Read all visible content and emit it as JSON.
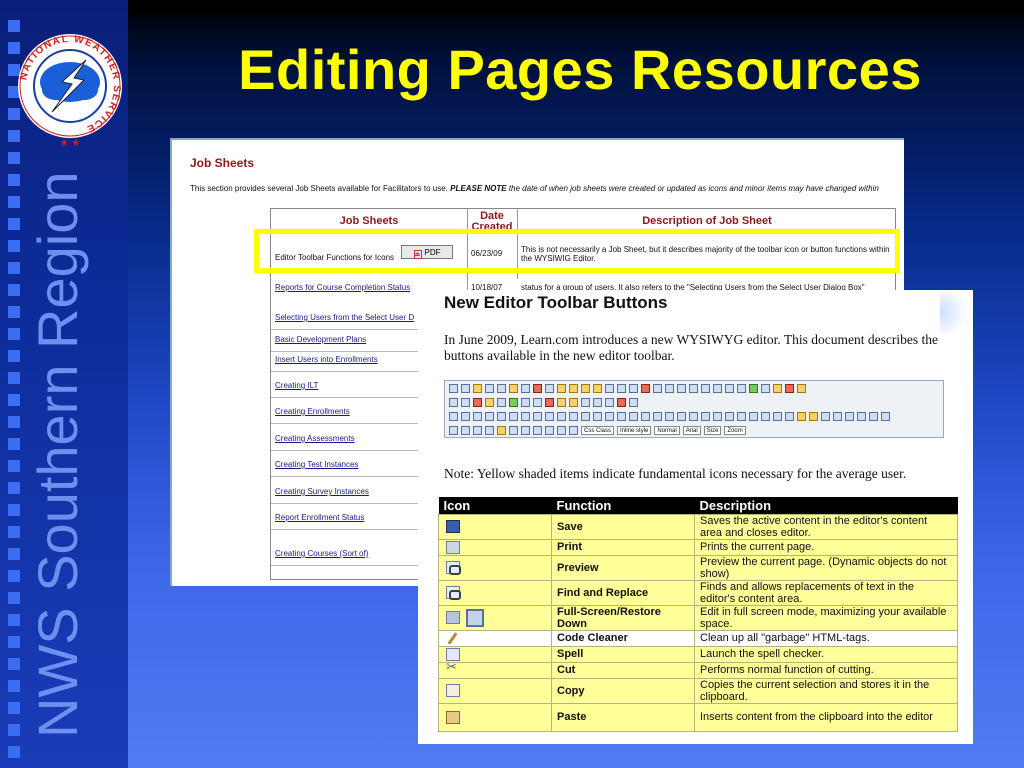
{
  "slide": {
    "title": "Editing Pages Resources",
    "side_title": "NWS Southern Region",
    "logo_ring_text": "NATIONAL WEATHER SERVICE"
  },
  "job_sheets": {
    "title": "Job Sheets",
    "intro_plain": "This section provides several Job Sheets available for Facilitators to use.",
    "intro_note": "PLEASE NOTE",
    "intro_rest": "the date of when job sheets were created or updated as icons and minor items may have changed within",
    "headers": {
      "sheet": "Job Sheets",
      "date": "Date Created",
      "desc": "Description of Job Sheet"
    },
    "pdf_label": "PDF",
    "rows": [
      {
        "name": "Editor Toolbar Functions for Icons",
        "date": "06/23/09",
        "desc": "This is not necessarily a Job Sheet, but it describes majority of the toolbar icon or button functions within the WYSIWIG Editor."
      },
      {
        "name": "Reports for Course Completion Status",
        "date": "10/18/07",
        "desc": "status for a group of users. It also refers to the \"Selecting Users from the Select User Dialog Box\""
      },
      {
        "name": "Selecting Users from the Select User D"
      },
      {
        "name": "Basic Development Plans"
      },
      {
        "name": "Insert Users into Enrollments"
      },
      {
        "name": "Creating ILT"
      },
      {
        "name": "Creating Enrollments"
      },
      {
        "name": "Creating Assessments"
      },
      {
        "name": "Creating Test Instances"
      },
      {
        "name": "Creating Survey Instances"
      },
      {
        "name": "Report Enrollment Status"
      },
      {
        "name": "Creating Courses (Sort of)"
      }
    ]
  },
  "editor_doc": {
    "title": "New Editor Toolbar Buttons",
    "intro": "In June 2009, Learn.com introduces a new WYSIWYG editor. This document describes the buttons available in the new editor toolbar.",
    "toolbar_selects": [
      "Css Class",
      "Inline style",
      "Normal",
      "Arial",
      "Size",
      "Zoom"
    ],
    "note": "Note: Yellow shaded items indicate fundamental icons necessary for the average user.",
    "table_headers": {
      "icon": "Icon",
      "function": "Function",
      "description": "Description"
    },
    "rows": [
      {
        "icon": "save-icon",
        "function": "Save",
        "description": "Saves the active content in the editor's content area and closes editor.",
        "shade": "yellow"
      },
      {
        "icon": "print-icon",
        "function": "Print",
        "description": "Prints the current page.",
        "shade": "yellow"
      },
      {
        "icon": "preview-icon",
        "function": "Preview",
        "description": "Preview the current page. (Dynamic objects do not show)",
        "shade": "yellow"
      },
      {
        "icon": "find-replace-icon",
        "function": "Find and Replace",
        "description": "Finds and allows replacements of text in the editor's content area.",
        "shade": "yellow"
      },
      {
        "icon": "fullscreen-icon",
        "function": "Full-Screen/Restore Down",
        "description": "Edit in full screen mode, maximizing your available space.",
        "shade": "yellow"
      },
      {
        "icon": "code-cleaner-icon",
        "function": "Code Cleaner",
        "description": "Clean up all \"garbage\" HTML-tags.",
        "shade": "white"
      },
      {
        "icon": "spell-icon",
        "function": "Spell",
        "description": "Launch the spell checker.",
        "shade": "yellow"
      },
      {
        "icon": "cut-icon",
        "function": "Cut",
        "description": "Performs normal function of cutting.",
        "shade": "yellow"
      },
      {
        "icon": "copy-icon",
        "function": "Copy",
        "description": "Copies the current selection and stores it in the clipboard.",
        "shade": "yellow"
      },
      {
        "icon": "paste-icon",
        "function": "Paste",
        "description": "Inserts content from the clipboard into the editor",
        "shade": "yellow"
      }
    ]
  },
  "colors": {
    "title_yellow": "#ffff00",
    "highlight_yellow": "#ffff99",
    "job_title_red": "#8b1a1a"
  }
}
